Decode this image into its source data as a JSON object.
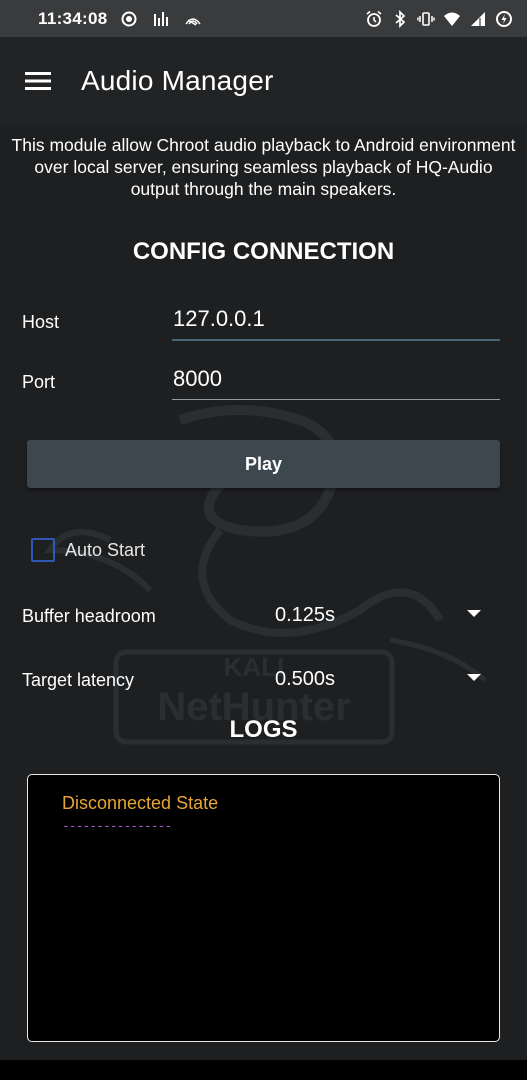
{
  "status_bar": {
    "time": "11:34:08",
    "left_icons": [
      "record-icon",
      "signal-bars-icon",
      "cast-icon"
    ],
    "right_icons": [
      "alarm-icon",
      "bluetooth-icon",
      "vibrate-icon",
      "wifi-icon",
      "cell-signal-icon",
      "battery-saver-icon"
    ]
  },
  "app_bar": {
    "title": "Audio Manager",
    "menu_icon": "hamburger-menu-icon"
  },
  "main": {
    "description": "This module allow Chroot audio playback to Android environment over local server, ensuring seamless playback of HQ-Audio output through the main speakers.",
    "config_heading": "CONFIG CONNECTION",
    "host": {
      "label": "Host",
      "value": "127.0.0.1"
    },
    "port": {
      "label": "Port",
      "value": "8000"
    },
    "play_label": "Play",
    "auto_start": {
      "label": "Auto Start",
      "checked": false
    },
    "buffer_headroom": {
      "label": "Buffer headroom",
      "value": "0.125s"
    },
    "target_latency": {
      "label": "Target latency",
      "value": "0.500s"
    },
    "logs_heading": "LOGS",
    "logs": {
      "state": "Disconnected State",
      "separator": "----------------",
      "state_color": "#e8a634",
      "separator_color": "#a65ac7"
    }
  },
  "watermark": {
    "line1": "KALI",
    "line2": "NetHunter"
  },
  "colors": {
    "background": "#1e1f20",
    "status_bar": "#3a3b3c",
    "button": "#3d474e",
    "checkbox_accent": "#2f57b8",
    "host_underline": "#4a6577"
  }
}
